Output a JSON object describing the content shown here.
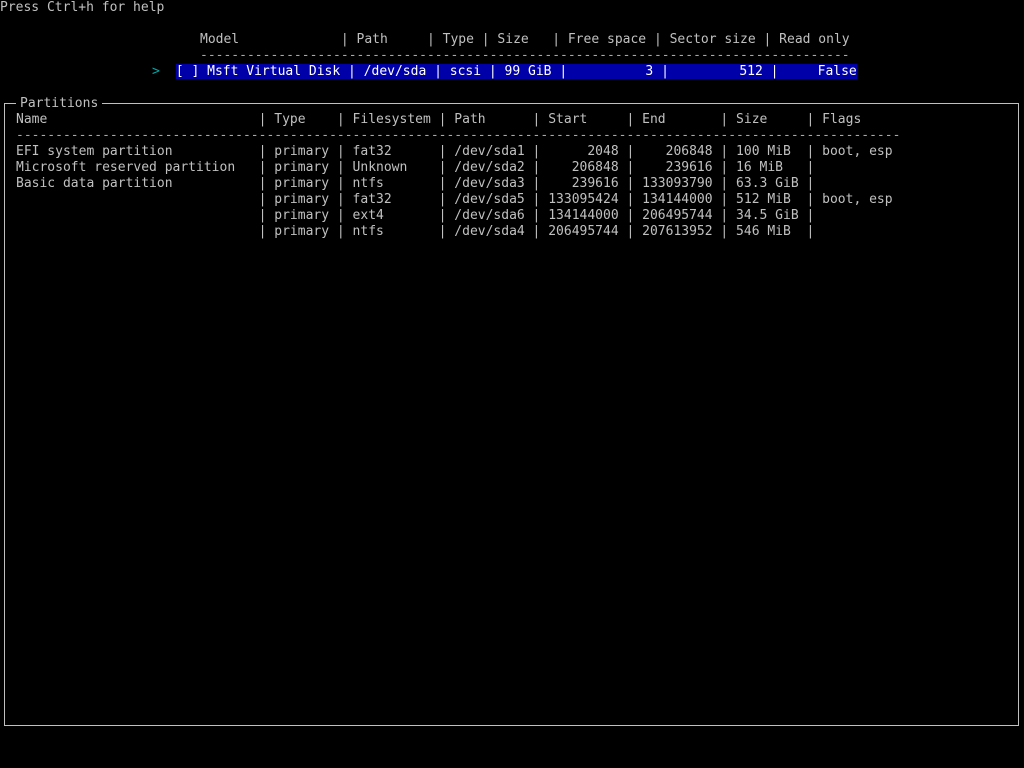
{
  "help_hint": "Press Ctrl+h for help",
  "disk_table": {
    "header": "Model             | Path     | Type | Size   | Free space | Sector size | Read only",
    "divider": "-----------------------------------------------------------------------------------",
    "cursor_glyph": ">",
    "rows": [
      {
        "checkbox": "[ ]",
        "text": "Msft Virtual Disk | /dev/sda | scsi | 99 GiB |          3 |         512 |     False",
        "selected": true
      }
    ]
  },
  "partitions": {
    "title": "Partitions",
    "header": "Name                           | Type    | Filesystem | Path      | Start     | End       | Size     | Flags",
    "divider": "-----------------------------------------------------------------------------------------------------------------",
    "rows": [
      {
        "text": "EFI system partition           | primary | fat32      | /dev/sda1 |      2048 |    206848 | 100 MiB  | boot, esp"
      },
      {
        "text": "Microsoft reserved partition   | primary | Unknown    | /dev/sda2 |    206848 |    239616 | 16 MiB   |"
      },
      {
        "text": "Basic data partition           | primary | ntfs       | /dev/sda3 |    239616 | 133093790 | 63.3 GiB |"
      },
      {
        "text": "                               | primary | fat32      | /dev/sda5 | 133095424 | 134144000 | 512 MiB  | boot, esp"
      },
      {
        "text": "                               | primary | ext4       | /dev/sda6 | 134144000 | 206495744 | 34.5 GiB |"
      },
      {
        "text": "                               | primary | ntfs       | /dev/sda4 | 206495744 | 207613952 | 546 MiB  |"
      }
    ]
  },
  "colors": {
    "background": "#000000",
    "text": "#c0c0c0",
    "selection_background": "#0000a8",
    "selection_text": "#ffffff",
    "cursor": "#00a8a8"
  }
}
